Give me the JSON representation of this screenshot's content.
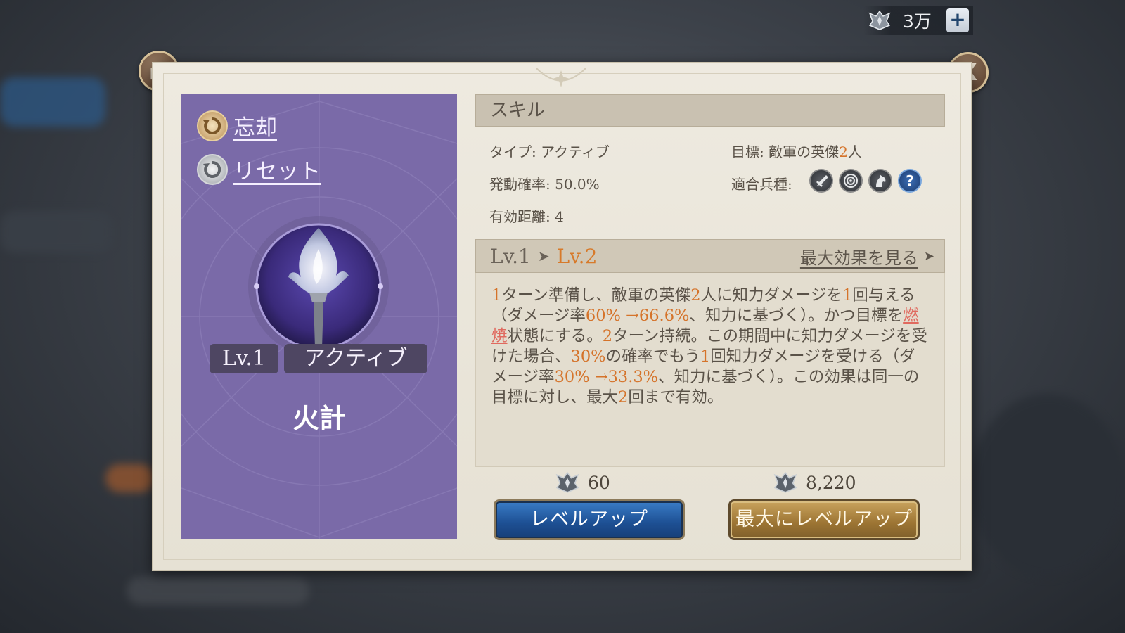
{
  "currency": {
    "amount": "3万",
    "add_label": "+",
    "icon": "crest-icon"
  },
  "dialog": {
    "share_icon": "share-icon",
    "close_label": "X"
  },
  "card": {
    "forget_label": "忘却",
    "reset_label": "リセット",
    "level_badge": "Lv.1",
    "type_badge": "アクティブ",
    "skill_name": "火計",
    "skill_icon": "torch-flame-icon"
  },
  "skill": {
    "header": "スキル",
    "type": "タイプ: アクティブ",
    "target_prefix": "目標: 敵軍の英傑",
    "target_count": "2",
    "target_suffix": "人",
    "chance": "発動確率: 50.0%",
    "troop_label": "適合兵種:",
    "troops": [
      "sword-icon",
      "bow-target-icon",
      "horse-icon",
      "question-icon"
    ],
    "range": "有効距離: 4"
  },
  "level": {
    "from": "Lv.1",
    "to": "Lv.2",
    "max_link": "最大効果を見る"
  },
  "description": {
    "p1a": "1",
    "p1b": "ターン準備し、敵軍の英傑",
    "p1c": "2",
    "p1d": "人に知力ダメージを",
    "p1e": "1",
    "p1f": "回与える（ダメージ率",
    "p1g": "60% →66.6%",
    "p1h": "、知力に基づく）。かつ目標を",
    "p1i": "燃焼",
    "p1j": "状態にする。",
    "p1k": "2",
    "p1l": "ターン持続。この期間中に知力ダメージを受けた場合、",
    "p1m": "30%",
    "p1n": "の確率でもう",
    "p1o": "1",
    "p1p": "回知力ダメージを受ける（ダメージ率",
    "p1q": "30% →33.3%",
    "p1r": "、知力に基づく）。この効果は同一の目標に対し、最大",
    "p1s": "2",
    "p1t": "回まで有効。"
  },
  "actions": {
    "level_up_cost": "60",
    "level_up_label": "レベルアップ",
    "max_cost": "8,220",
    "max_label": "最大にレベルアップ"
  },
  "colors": {
    "card_purple": "#7a6aa8",
    "highlight_orange": "#d5732a",
    "burn_red": "#e06a5f",
    "button_blue": "#1d4f93",
    "button_gold": "#9c7433"
  }
}
